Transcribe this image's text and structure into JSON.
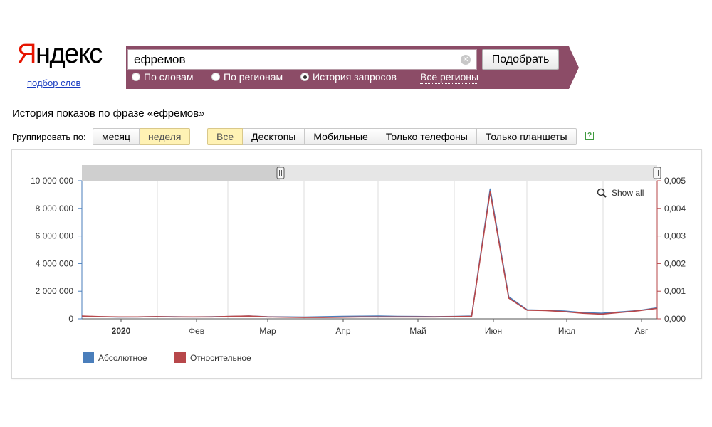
{
  "logo": {
    "first": "Я",
    "rest": "ндекс"
  },
  "subtitle_link": "подбор слов",
  "search": {
    "value": "ефремов",
    "clear_icon": "✕",
    "submit_label": "Подобрать"
  },
  "radio_options": [
    {
      "label": "По словам",
      "selected": false
    },
    {
      "label": "По регионам",
      "selected": false
    },
    {
      "label": "История запросов",
      "selected": true
    }
  ],
  "regions_link": "Все регионы",
  "page_title": "История показов по фразе «ефремов»",
  "grouping": {
    "label": "Группировать по:",
    "options": [
      {
        "label": "месяц",
        "active": false
      },
      {
        "label": "неделя",
        "active": true
      }
    ]
  },
  "device_filters": [
    {
      "label": "Все",
      "active": true
    },
    {
      "label": "Десктопы",
      "active": false
    },
    {
      "label": "Мобильные",
      "active": false
    },
    {
      "label": "Только телефоны",
      "active": false
    },
    {
      "label": "Только планшеты",
      "active": false
    }
  ],
  "help_icon": "?",
  "colors": {
    "band": "#8c4c67",
    "absolute": "#4a7ebb",
    "relative": "#b7474a",
    "active_button": "#fff2b4",
    "logo_red": "#e61400"
  },
  "chart_data": {
    "type": "line",
    "show_all_label": "Show all",
    "x_ticks": [
      "2020",
      "Фев",
      "Мар",
      "Апр",
      "Май",
      "Июн",
      "Июл",
      "Авг"
    ],
    "y_left_ticks": [
      "0",
      "2 000 000",
      "4 000 000",
      "6 000 000",
      "8 000 000",
      "10 000 000"
    ],
    "y_right_ticks": [
      "0,000",
      "0,001",
      "0,002",
      "0,003",
      "0,004",
      "0,005"
    ],
    "ylim_left": [
      0,
      10000000
    ],
    "ylim_right": [
      0,
      0.005
    ],
    "grid": true,
    "legend_position": "bottom-left",
    "x_weeks": [
      0,
      1,
      2,
      3,
      4,
      5,
      6,
      7,
      8,
      9,
      10,
      11,
      12,
      13,
      14,
      15,
      16,
      17,
      18,
      19,
      20,
      21,
      22,
      23,
      24,
      25,
      26,
      27,
      28,
      29,
      30,
      31
    ],
    "series": [
      {
        "name": "Абсолютное",
        "axis": "left",
        "values": [
          180000,
          150000,
          130000,
          140000,
          160000,
          150000,
          140000,
          150000,
          170000,
          200000,
          150000,
          140000,
          130000,
          150000,
          180000,
          190000,
          200000,
          180000,
          170000,
          160000,
          170000,
          200000,
          9400000,
          1600000,
          650000,
          620000,
          560000,
          450000,
          400000,
          500000,
          600000,
          800000
        ]
      },
      {
        "name": "Относительное",
        "axis": "right",
        "values": [
          0.0001,
          8e-05,
          7e-05,
          7e-05,
          8e-05,
          7e-05,
          7e-05,
          7e-05,
          9e-05,
          0.0001,
          7e-05,
          6e-05,
          5e-05,
          5e-05,
          6e-05,
          7e-05,
          7e-05,
          7e-05,
          7e-05,
          7e-05,
          8e-05,
          9e-05,
          0.0046,
          0.00075,
          0.00031,
          0.0003,
          0.00026,
          0.0002,
          0.00017,
          0.00023,
          0.00029,
          0.00038
        ]
      }
    ]
  }
}
